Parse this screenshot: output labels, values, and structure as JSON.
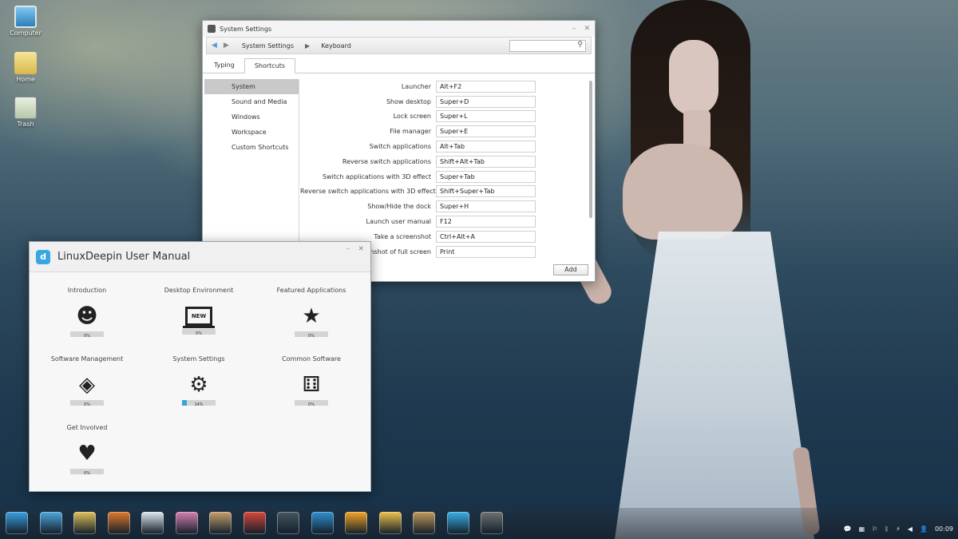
{
  "desktop": {
    "icons": [
      {
        "label": "Computer",
        "icon": "computer-icon"
      },
      {
        "label": "Home",
        "icon": "home-folder-icon"
      },
      {
        "label": "Trash",
        "icon": "trash-icon"
      }
    ]
  },
  "settings": {
    "title": "System Settings",
    "nav": {
      "back": "◀",
      "forward": "▶",
      "crumb1": "System Settings",
      "separator": "▶",
      "crumb2": "Keyboard",
      "search_placeholder": "",
      "search_icon": "⚲"
    },
    "tabs": [
      "Typing",
      "Shortcuts"
    ],
    "active_tab": "Shortcuts",
    "sidebar": [
      "System",
      "Sound and Media",
      "Windows",
      "Workspace",
      "Custom Shortcuts"
    ],
    "active_sidebar": "System",
    "shortcuts": [
      {
        "name": "Launcher",
        "key": "Alt+F2"
      },
      {
        "name": "Show desktop",
        "key": "Super+D"
      },
      {
        "name": "Lock screen",
        "key": "Super+L"
      },
      {
        "name": "File manager",
        "key": "Super+E"
      },
      {
        "name": "Switch applications",
        "key": "Alt+Tab"
      },
      {
        "name": "Reverse switch applications",
        "key": "Shift+Alt+Tab"
      },
      {
        "name": "Switch applications with 3D effect",
        "key": "Super+Tab"
      },
      {
        "name": "Reverse switch applications with 3D effect",
        "key": "Shift+Super+Tab"
      },
      {
        "name": "Show/Hide the dock",
        "key": "Super+H"
      },
      {
        "name": "Launch user manual",
        "key": "F12"
      },
      {
        "name": "Take a screenshot",
        "key": "Ctrl+Alt+A"
      },
      {
        "name": "Take a screenshot of full screen",
        "key": "Print"
      }
    ],
    "add_label": "Add",
    "window_buttons": {
      "minimize": "–",
      "close": "✕"
    }
  },
  "manual": {
    "title": "LinuxDeepin User Manual",
    "logo": "d",
    "window_buttons": {
      "minimize": "–",
      "close": "✕"
    },
    "cards": [
      {
        "title": "Introduction",
        "icon": "face-icon",
        "glyph": "☻",
        "progress": 0,
        "progress_label": "0%"
      },
      {
        "title": "Desktop Environment",
        "icon": "new-monitor-icon",
        "glyph": "NEW",
        "progress": 0,
        "progress_label": "0%"
      },
      {
        "title": "Featured Applications",
        "icon": "star-icon",
        "glyph": "★",
        "progress": 0,
        "progress_label": "0%"
      },
      {
        "title": "Software Management",
        "icon": "software-center-icon",
        "glyph": "◈",
        "progress": 0,
        "progress_label": "0%"
      },
      {
        "title": "System Settings",
        "icon": "gear-icon",
        "glyph": "⚙",
        "progress": 14,
        "progress_label": "14%"
      },
      {
        "title": "Common Software",
        "icon": "dice-icon",
        "glyph": "⚅",
        "progress": 0,
        "progress_label": "0%"
      },
      {
        "title": "Get Involved",
        "icon": "heart-house-icon",
        "glyph": "♥",
        "progress": 0,
        "progress_label": "0%"
      }
    ]
  },
  "taskbar": {
    "dock_items": [
      {
        "name": "launcher-icon",
        "color": "#3a9fe0"
      },
      {
        "name": "desktop-icon",
        "color": "#4fa6dc"
      },
      {
        "name": "file-manager-icon",
        "color": "#e0c15a"
      },
      {
        "name": "firefox-icon",
        "color": "#e2782a"
      },
      {
        "name": "text-editor-icon",
        "color": "#dfe8f0"
      },
      {
        "name": "paint-icon",
        "color": "#d77fb0"
      },
      {
        "name": "piano-icon",
        "color": "#c7a06a"
      },
      {
        "name": "music-player-icon",
        "color": "#d8473a"
      },
      {
        "name": "media-icon",
        "color": "#455660"
      },
      {
        "name": "deepin-talk-icon",
        "color": "#2f8fd0"
      },
      {
        "name": "deepin-music-icon",
        "color": "#f5a623"
      },
      {
        "name": "translator-icon",
        "color": "#f1c24a"
      },
      {
        "name": "installer-icon",
        "color": "#c49a5c"
      },
      {
        "name": "system-monitor-icon",
        "color": "#3ab0e8"
      },
      {
        "name": "settings-app-icon",
        "color": "#707070"
      }
    ],
    "tray": {
      "chat": "💬",
      "network": "▦",
      "wifi": "⚐",
      "bluetooth": "ᛒ",
      "power": "⚡",
      "volume": "◀",
      "user": "👤",
      "clock": "00:09"
    }
  }
}
